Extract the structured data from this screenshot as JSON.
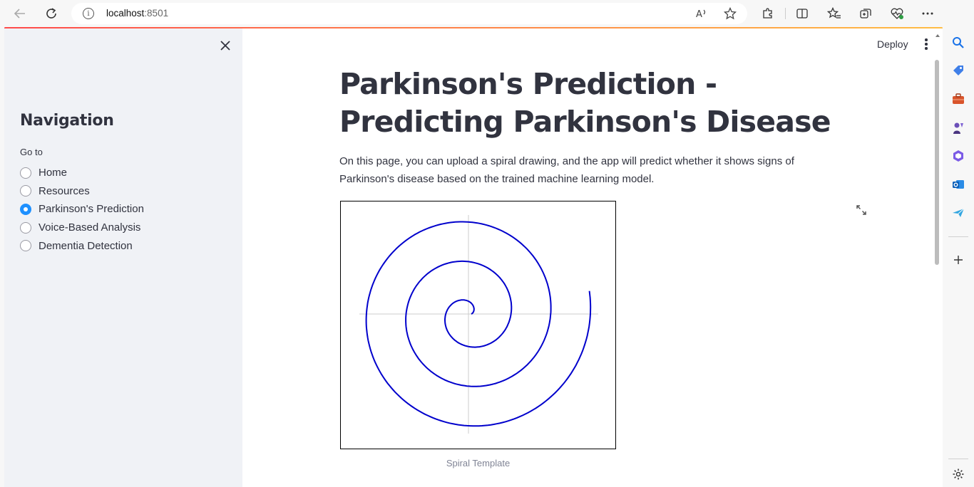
{
  "browser": {
    "url_host": "localhost",
    "url_port": ":8501"
  },
  "header": {
    "deploy_label": "Deploy"
  },
  "sidebar": {
    "title": "Navigation",
    "radio_label": "Go to",
    "options": [
      {
        "label": "Home",
        "selected": false
      },
      {
        "label": "Resources",
        "selected": false
      },
      {
        "label": "Parkinson's Prediction",
        "selected": true
      },
      {
        "label": "Voice-Based Analysis",
        "selected": false
      },
      {
        "label": "Dementia Detection",
        "selected": false
      }
    ]
  },
  "main": {
    "title": "Parkinson's Prediction - Predicting Parkinson's Disease",
    "intro": "On this page, you can upload a spiral drawing, and the app will predict whether it shows signs of Parkinson's disease based on the trained machine learning model.",
    "image_caption": "Spiral Template"
  },
  "colors": {
    "accent": "#ff4b4b",
    "spiral": "#0000cc",
    "radio_selected": "#1e90ff",
    "sidebar_bg": "#f0f2f6",
    "text": "#31333f"
  },
  "icons": {
    "back": "arrow-left-icon",
    "refresh": "refresh-icon",
    "info": "info-icon",
    "read_aloud": "read-aloud-icon",
    "favorite": "star-icon",
    "extensions": "puzzle-icon",
    "split": "split-screen-icon",
    "favorites": "favorites-list-icon",
    "collections": "collections-icon",
    "performance": "heart-pulse-icon",
    "more": "more-dots-icon",
    "copilot": "copilot-icon",
    "close": "close-icon",
    "menu": "kebab-menu-icon",
    "fullscreen": "fullscreen-icon"
  }
}
